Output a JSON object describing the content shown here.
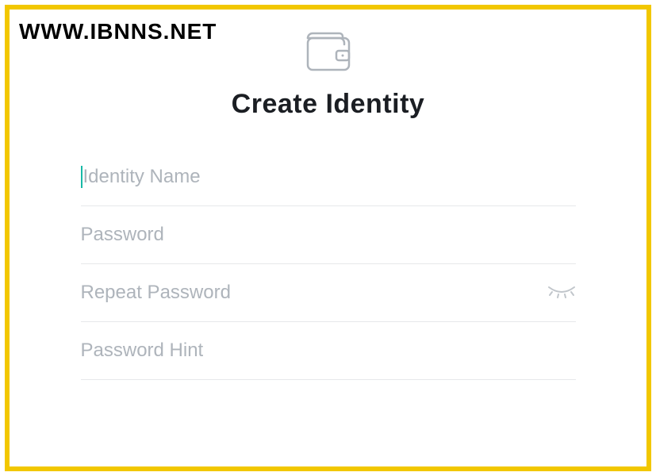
{
  "watermark": "WWW.IBNNS.NET",
  "title": "Create Identity",
  "fields": {
    "identity": {
      "placeholder": "Identity Name",
      "value": ""
    },
    "password": {
      "placeholder": "Password",
      "value": ""
    },
    "repeat": {
      "placeholder": "Repeat Password",
      "value": ""
    },
    "hint": {
      "placeholder": "Password Hint",
      "value": ""
    }
  },
  "icons": {
    "wallet": "wallet-icon",
    "eye_hidden": "eye-hidden-icon"
  }
}
